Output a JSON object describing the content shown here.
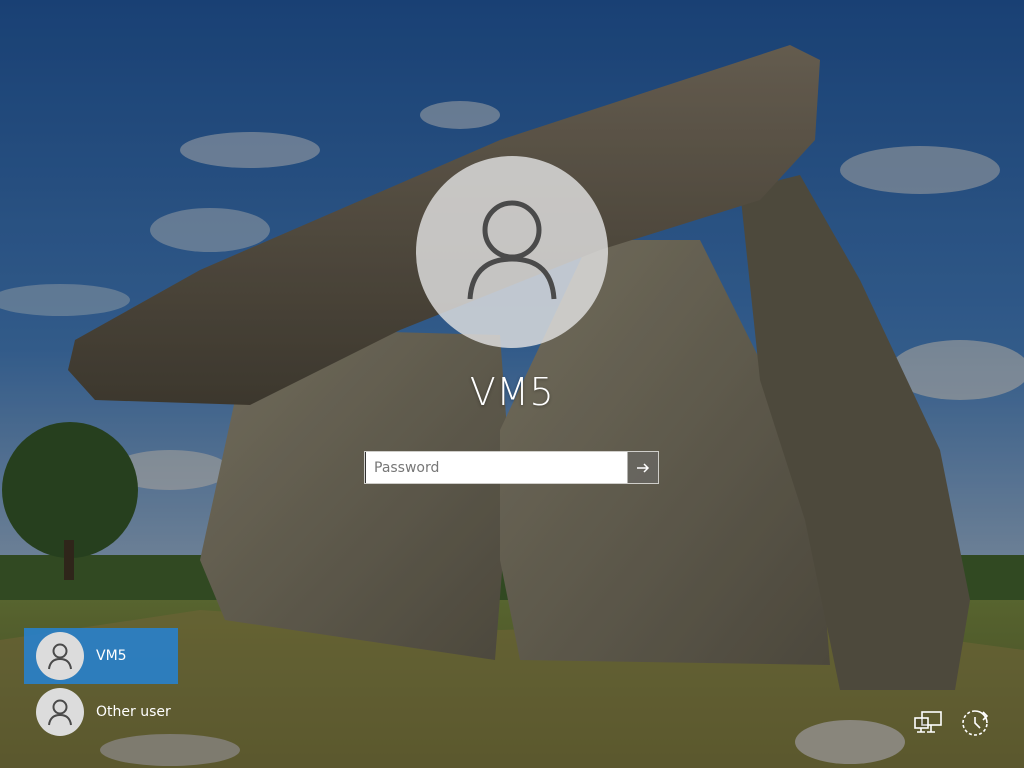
{
  "login": {
    "username": "VM5",
    "password_placeholder": "Password",
    "password_value": ""
  },
  "user_list": [
    {
      "label": "VM5",
      "selected": true
    },
    {
      "label": "Other user",
      "selected": false
    }
  ],
  "tray_icons": [
    "network-icon",
    "ease-of-access-icon"
  ],
  "colors": {
    "selected_user": "#2980c8",
    "text": "#ffffff"
  }
}
